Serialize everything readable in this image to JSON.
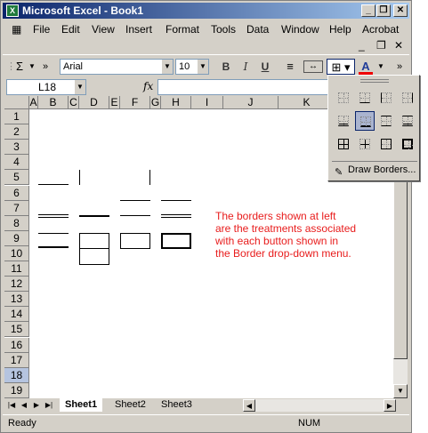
{
  "window": {
    "title": "Microsoft Excel - Book1",
    "icon": "excel-icon",
    "minimize": "_",
    "restore": "❐",
    "close": "✕"
  },
  "menu": [
    "File",
    "Edit",
    "View",
    "Insert",
    "Format",
    "Tools",
    "Data",
    "Window",
    "Help",
    "Acrobat"
  ],
  "mdi": {
    "minimize": "_",
    "restore": "❐",
    "close": "✕"
  },
  "toolbar": {
    "autosum": "Σ",
    "font": "Arial",
    "size": "10",
    "bold": "B",
    "italic": "I",
    "underline": "U",
    "font_color_letter": "A",
    "more": "»"
  },
  "formula_bar": {
    "cell_ref": "L18",
    "fx": "fx"
  },
  "columns": [
    "A",
    "B",
    "C",
    "D",
    "E",
    "F",
    "G",
    "H",
    "I",
    "J",
    "K"
  ],
  "rows": [
    "1",
    "2",
    "3",
    "4",
    "5",
    "6",
    "7",
    "8",
    "9",
    "10",
    "11",
    "12",
    "13",
    "14",
    "15",
    "16",
    "17",
    "18",
    "19"
  ],
  "selected_row": "18",
  "sheets": [
    "Sheet1",
    "Sheet2",
    "Sheet3"
  ],
  "active_sheet": "Sheet1",
  "status": {
    "left": "Ready",
    "num": "NUM"
  },
  "annotation": "The borders shown at left\nare the treatments associated\nwith each button shown in\nthe Border drop-down menu.",
  "annotation_color": "#e81c1c",
  "border_menu": {
    "draw_borders": "Draw Borders..."
  }
}
